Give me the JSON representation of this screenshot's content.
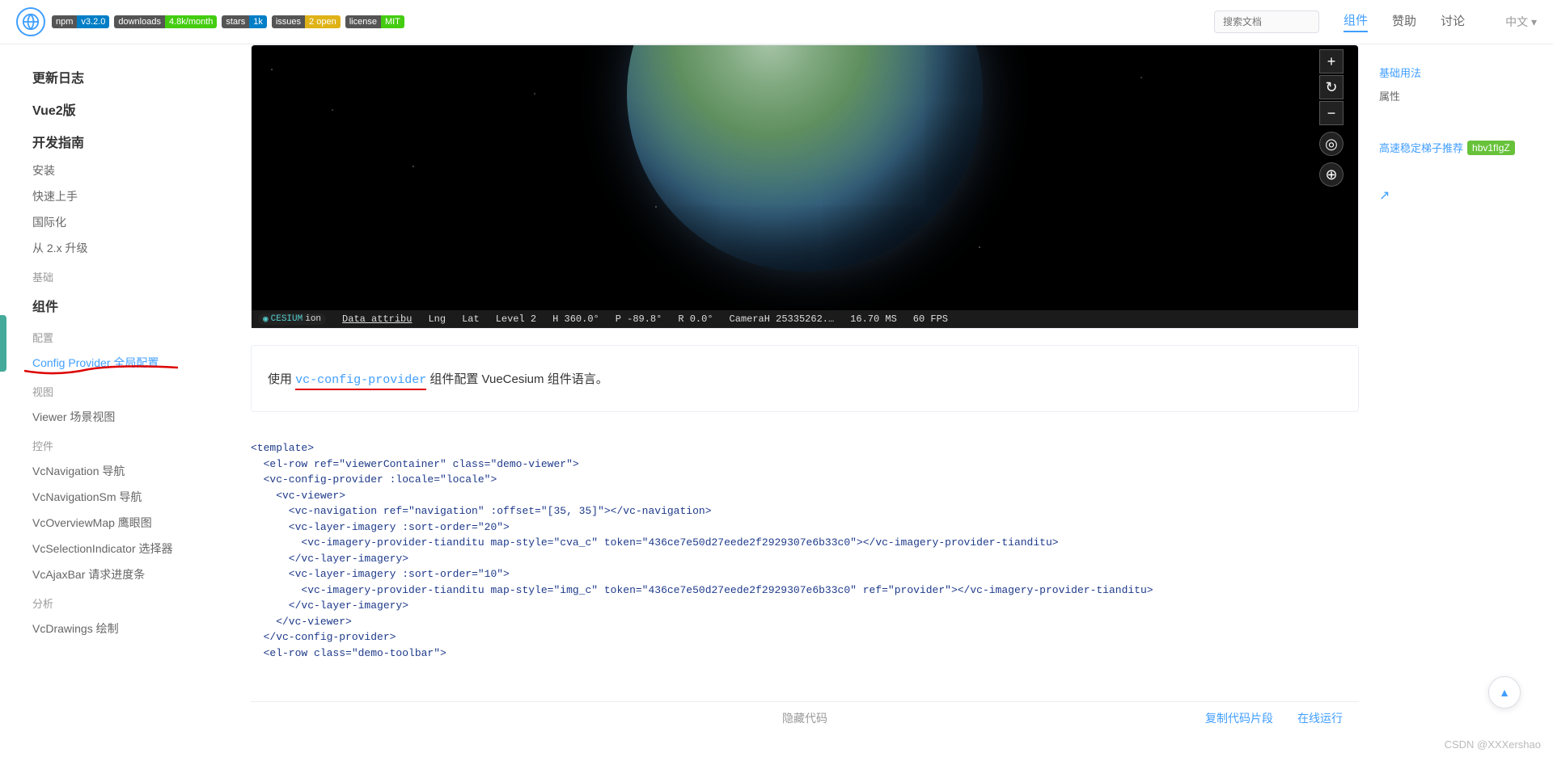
{
  "badges": [
    {
      "left": "npm",
      "right": "v3.2.0",
      "color": "#007ec6"
    },
    {
      "left": "downloads",
      "right": "4.8k/month",
      "color": "#4c1"
    },
    {
      "left": "stars",
      "right": "1k",
      "color": "#007ec6"
    },
    {
      "left": "issues",
      "right": "2 open",
      "color": "#dfb317"
    },
    {
      "left": "license",
      "right": "MIT",
      "color": "#4c1"
    }
  ],
  "search_placeholder": "搜索文档",
  "nav": {
    "components": "组件",
    "sponsor": "赞助",
    "discuss": "讨论",
    "lang": "中文 ▾"
  },
  "sidebar": {
    "changelog": "更新日志",
    "vue2": "Vue2版",
    "guide": "开发指南",
    "install": "安装",
    "quickstart": "快速上手",
    "i18n": "国际化",
    "upgrade": "从 2.x 升级",
    "basic": "基础",
    "components": "组件",
    "config": "配置",
    "config_provider": "Config Provider 全局配置",
    "view": "视图",
    "viewer": "Viewer 场景视图",
    "controls": "控件",
    "nav1": "VcNavigation 导航",
    "nav2": "VcNavigationSm 导航",
    "overview": "VcOverviewMap 鹰眼图",
    "selection": "VcSelectionIndicator 选择器",
    "ajax": "VcAjaxBar 请求进度条",
    "analysis": "分析",
    "drawings": "VcDrawings 绘制"
  },
  "status": {
    "cesium_c": "CESIUM",
    "cesium_i": "ion",
    "attr": "Data attribu",
    "lng": "Lng",
    "lat": "Lat",
    "level": "Level  2",
    "h": "H  360.0°",
    "p": "P  -89.8°",
    "r": "R  0.0°",
    "cam": "CameraH  25335262.…",
    "ms": "16.70 MS",
    "fps": "60 FPS"
  },
  "desc": {
    "pre": "使用 ",
    "code": "vc-config-provider",
    "post": " 组件配置 VueCesium 组件语言。"
  },
  "code": [
    "<template>",
    "  <el-row ref=\"viewerContainer\" class=\"demo-viewer\">",
    "  <vc-config-provider :locale=\"locale\">",
    "    <vc-viewer>",
    "      <vc-navigation ref=\"navigation\" :offset=\"[35, 35]\"></vc-navigation>",
    "      <vc-layer-imagery :sort-order=\"20\">",
    "        <vc-imagery-provider-tianditu map-style=\"cva_c\" token=\"436ce7e50d27eede2f2929307e6b33c0\"></vc-imagery-provider-tianditu>",
    "      </vc-layer-imagery>",
    "      <vc-layer-imagery :sort-order=\"10\">",
    "        <vc-imagery-provider-tianditu map-style=\"img_c\" token=\"436ce7e50d27eede2f2929307e6b33c0\" ref=\"provider\"></vc-imagery-provider-tianditu>",
    "      </vc-layer-imagery>",
    "    </vc-viewer>",
    "  </vc-config-provider>",
    "  <el-row class=\"demo-toolbar\">"
  ],
  "footer": {
    "hide": "隐藏代码",
    "copy": "复制代码片段",
    "run": "在线运行"
  },
  "toc": {
    "usage": "基础用法",
    "props": "属性"
  },
  "promo": {
    "text": "高速稳定梯子推荐",
    "badge": "hbv1fIgZ"
  },
  "watermark": "CSDN @XXXershao"
}
